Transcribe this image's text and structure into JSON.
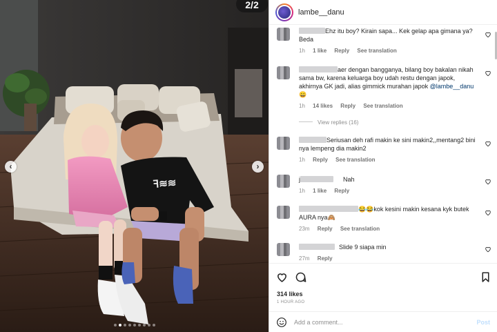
{
  "post": {
    "slide_counter": "2/2",
    "slide_count": 9,
    "active_slide": 1,
    "nav_prev_icon": "chevron-left-icon",
    "nav_next_icon": "chevron-right-icon"
  },
  "header": {
    "username": "lambe__danu",
    "avatar_icon": "profile-avatar"
  },
  "comments": [
    {
      "text": "Ehz itu boy? Kirain sapa... Kek gelap apa gimana ya? Beda",
      "time": "1h",
      "likes": "1 like",
      "reply": "Reply",
      "translate": "See translation"
    },
    {
      "text": "aer dengan bangganya, bilang boy bakalan nikah sama bw, karena keluarga boy udah restu dengan japok, akhirnya GK jadi, alias gimmick murahan japok ",
      "mention": "@lambe__danu",
      "emoji": "😀",
      "time": "1h",
      "likes": "14 likes",
      "reply": "Reply",
      "translate": "See translation",
      "view_replies": "View replies (16)"
    },
    {
      "text": "Seriusan deh rafi makin ke sini makin2,,mentang2 bini nya lempeng dia makin2",
      "time": "1h",
      "reply": "Reply",
      "translate": "See translation"
    },
    {
      "prefix": "j",
      "text": "Nah",
      "time": "1h",
      "likes": "1 like",
      "reply": "Reply"
    },
    {
      "emoji": "😂😂",
      "text": "kok kesini makin kesana kyk butek AURA nya",
      "emoji_end": "🙈",
      "time": "23m",
      "reply": "Reply",
      "translate": "See translation"
    },
    {
      "text": "Slide 9 siapa min",
      "time": "27m",
      "reply": "Reply"
    }
  ],
  "actions": {
    "like_icon": "heart-icon",
    "comment_icon": "comment-bubble-icon",
    "save_icon": "bookmark-icon",
    "likes_count": "314 likes",
    "timestamp": "1 HOUR AGO"
  },
  "add_comment": {
    "emoji_icon": "smiley-icon",
    "placeholder": "Add a comment...",
    "post_label": "Post"
  },
  "colors": {
    "link": "#00376b",
    "muted": "#8e8e8e",
    "post_disabled": "#c0dffd"
  }
}
